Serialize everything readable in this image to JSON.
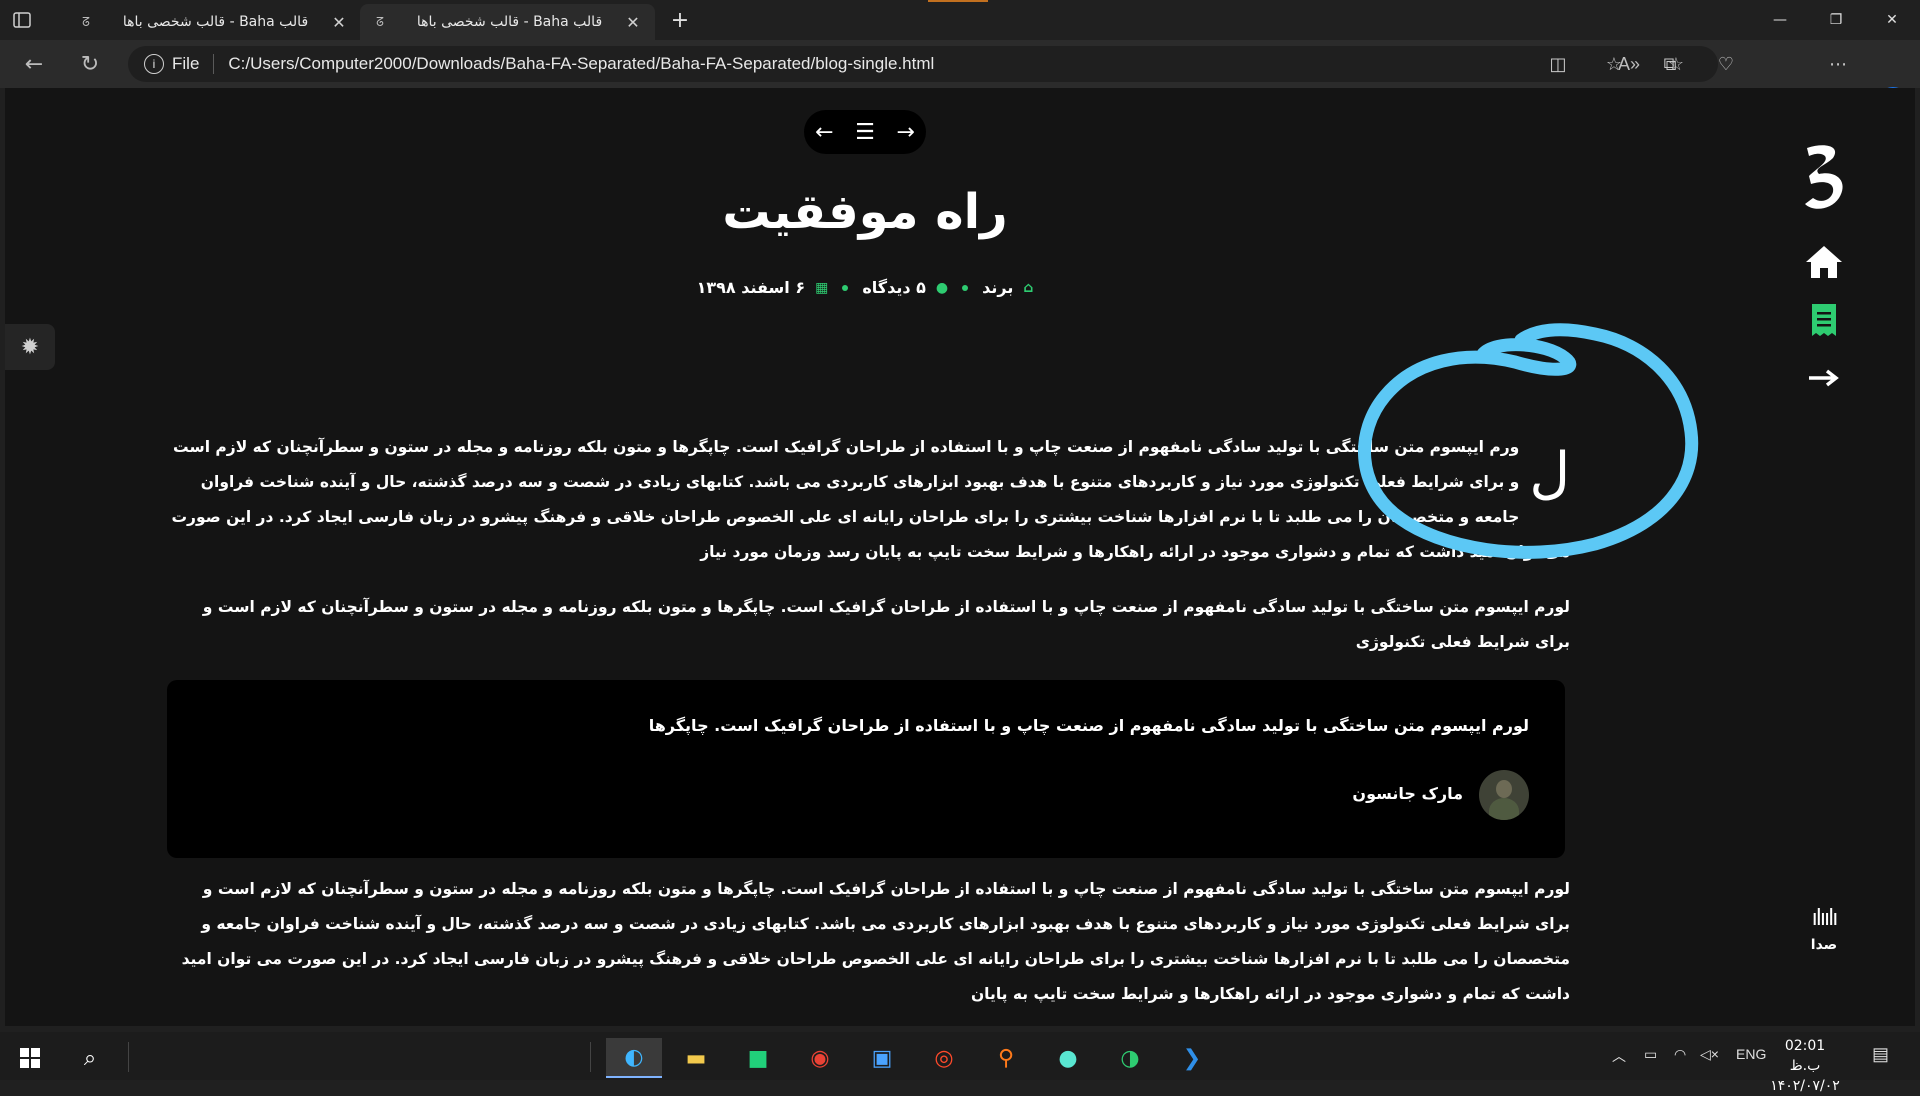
{
  "browser": {
    "tabs": [
      {
        "title": "قالب Baha - قالب شخصی باها",
        "active": false
      },
      {
        "title": "قالب Baha - قالب شخصی باها",
        "active": true
      }
    ],
    "file_label": "File",
    "url": "C:/Users/Computer2000/Downloads/Baha-FA-Separated/Baha-FA-Separated/blog-single.html"
  },
  "page": {
    "title": "راه موفقیت",
    "meta": {
      "author": "برند",
      "comments": "۵ دیدگاه",
      "date": "۶ اسفند ۱۳۹۸"
    },
    "paragraph1": {
      "dropcap": "ل",
      "text": "ورم ایپسوم متن ساختگی با تولید سادگی نامفهوم از صنعت چاپ و با استفاده از طراحان گرافیک است. چاپگرها و متون بلکه روزنامه و مجله در ستون و سطرآنچنان که لازم است و برای شرایط فعلی تکنولوژی مورد نیاز و کاربردهای متنوع با هدف بهبود ابزارهای کاربردی می باشد. کتابهای زیادی در شصت و سه درصد گذشته، حال و آینده شناخت فراوان جامعه و متخصصان را می طلبد تا با نرم افزارها شناخت بیشتری را برای طراحان رایانه ای علی الخصوص طراحان خلاقی و فرهنگ پیشرو در زبان فارسی ایجاد کرد. در این صورت می توان امید داشت که تمام و دشواری موجود در ارائه راهکارها و شرایط سخت تایپ به پایان رسد وزمان مورد نیاز"
    },
    "paragraph2": "لورم ایپسوم متن ساختگی با تولید سادگی نامفهوم از صنعت چاپ و با استفاده از طراحان گرافیک است. چاپگرها و متون بلکه روزنامه و مجله در ستون و سطرآنچنان که لازم است و برای شرایط فعلی تکنولوژی",
    "quote": {
      "text": "لورم ایپسوم متن ساختگی با تولید سادگی نامفهوم از صنعت چاپ و با استفاده از طراحان گرافیک است. چاپگرها",
      "author": "مارک جانسون"
    },
    "paragraph4": "لورم ایپسوم متن ساختگی با تولید سادگی نامفهوم از صنعت چاپ و با استفاده از طراحان گرافیک است. چاپگرها و متون بلکه روزنامه و مجله در ستون و سطرآنچنان که لازم است و برای شرایط فعلی تکنولوژی مورد نیاز و کاربردهای متنوع با هدف بهبود ابزارهای کاربردی می باشد. کتابهای زیادی در شصت و سه درصد گذشته، حال و آینده شناخت فراوان جامعه و متخصصان را می طلبد تا با نرم افزارها شناخت بیشتری را برای طراحان رایانه ای علی الخصوص طراحان خلاقی و فرهنگ پیشرو در زبان فارسی ایجاد کرد. در این صورت می توان امید داشت که تمام و دشواری موجود در ارائه راهکارها و شرایط سخت تایپ به پایان",
    "sound_label": "صدا"
  },
  "taskbar": {
    "language": "ENG",
    "time": "02:01 ب.ظ",
    "date": "۱۴۰۲/۰۷/۰۲"
  },
  "colors": {
    "accent": "#2ecc71",
    "scribble": "#5cc8f5",
    "page_bg": "#141414"
  }
}
